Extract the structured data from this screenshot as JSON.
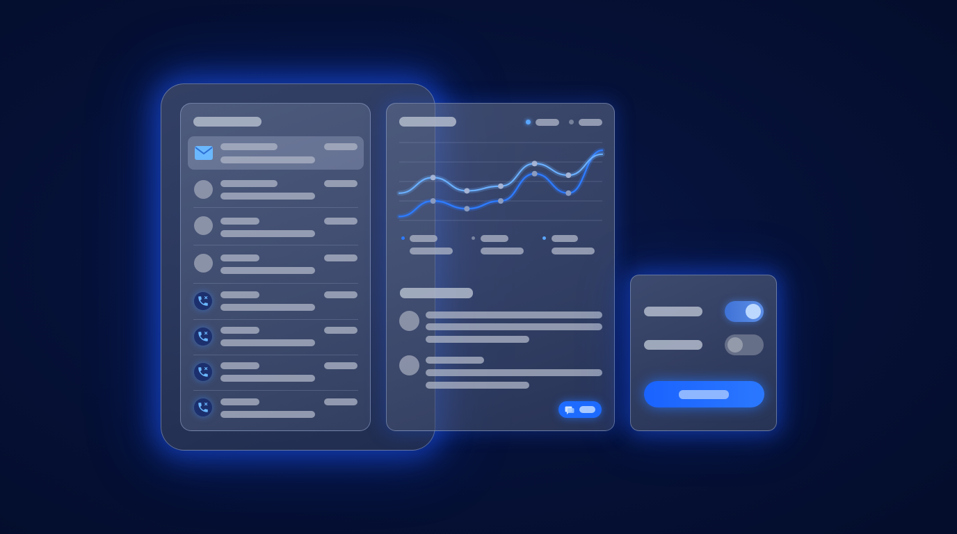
{
  "colors": {
    "background": "#06123a",
    "accent_blue": "#1e6cff",
    "accent_light_blue": "#5aa6ff",
    "panel_glass": "#56627f",
    "placeholder_bar": "#aab2c4"
  },
  "icons": {
    "mail": "envelope-icon",
    "call": "phone-icon",
    "chat": "chat-bubble-icon"
  },
  "toggles": {
    "first_on": true,
    "second_on": false
  },
  "chart_data": {
    "type": "line",
    "series": [
      {
        "values": [
          0.05,
          0.25,
          0.15,
          0.25,
          0.6,
          0.35,
          0.9
        ]
      },
      {
        "values": [
          0.35,
          0.55,
          0.38,
          0.44,
          0.73,
          0.58,
          0.85
        ]
      }
    ],
    "grid": true
  }
}
